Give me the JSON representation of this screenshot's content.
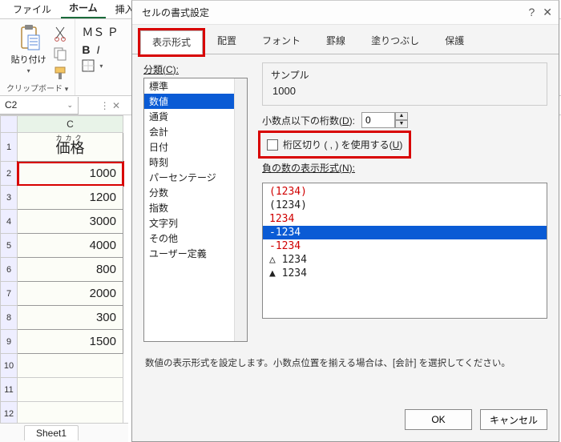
{
  "ribbon": {
    "tabs": [
      "ファイル",
      "ホーム",
      "挿入"
    ],
    "active_tab": "ホーム",
    "clipboard_label": "クリップボード",
    "paste_label": "貼り付け",
    "font_name": "ＭＳ Ｐ",
    "bold": "B",
    "italic": "I"
  },
  "namebox": {
    "ref": "C2"
  },
  "sheet": {
    "col_header": "C",
    "header_ruby": "カカク",
    "header_text": "価格",
    "values": [
      "1000",
      "1200",
      "3000",
      "4000",
      "800",
      "2000",
      "300",
      "1500"
    ],
    "tab": "Sheet1"
  },
  "dialog": {
    "title": "セルの書式設定",
    "tabs": [
      "表示形式",
      "配置",
      "フォント",
      "罫線",
      "塗りつぶし",
      "保護"
    ],
    "category_label_pre": "分類(",
    "category_label_key": "C",
    "category_label_post": "):",
    "categories": [
      "標準",
      "数値",
      "通貨",
      "会計",
      "日付",
      "時刻",
      "パーセンテージ",
      "分数",
      "指数",
      "文字列",
      "その他",
      "ユーザー定義"
    ],
    "selected_category": "数値",
    "sample_label": "サンプル",
    "sample_value": "1000",
    "decimals_label_pre": "小数点以下の桁数(",
    "decimals_label_key": "D",
    "decimals_label_post": "):",
    "decimals_value": "0",
    "separator_label_pre": "桁区切り ( , ) を使用する(",
    "separator_label_key": "U",
    "separator_label_post": ")",
    "neg_label_pre": "負の数の表示形式(",
    "neg_label_key": "N",
    "neg_label_post": "):",
    "neg_options": [
      {
        "text": "(1234)",
        "red": true
      },
      {
        "text": "(1234)",
        "red": false
      },
      {
        "text": "1234",
        "red": true
      },
      {
        "text": "-1234",
        "red": false,
        "sel": true
      },
      {
        "text": "-1234",
        "red": true
      },
      {
        "text": "△ 1234",
        "red": false
      },
      {
        "text": "▲ 1234",
        "red": false
      }
    ],
    "description": "数値の表示形式を設定します。小数点位置を揃える場合は、[会計] を選択してください。",
    "ok": "OK",
    "cancel": "キャンセル"
  }
}
